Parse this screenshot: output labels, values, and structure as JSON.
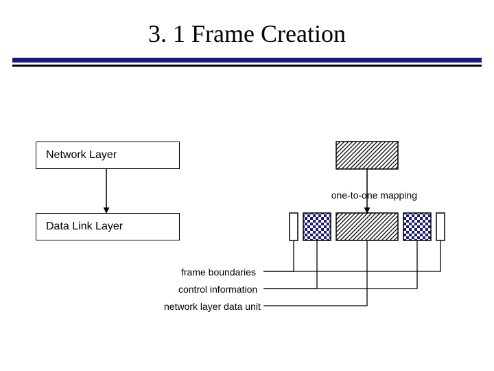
{
  "title": "3. 1 Frame Creation",
  "boxes": {
    "network_layer": "Network Layer",
    "data_link_layer": "Data Link Layer"
  },
  "labels": {
    "mapping": "one-to-one mapping",
    "frame_boundaries": "frame boundaries",
    "control_information": "control information",
    "network_layer_data_unit": "network layer data unit"
  }
}
